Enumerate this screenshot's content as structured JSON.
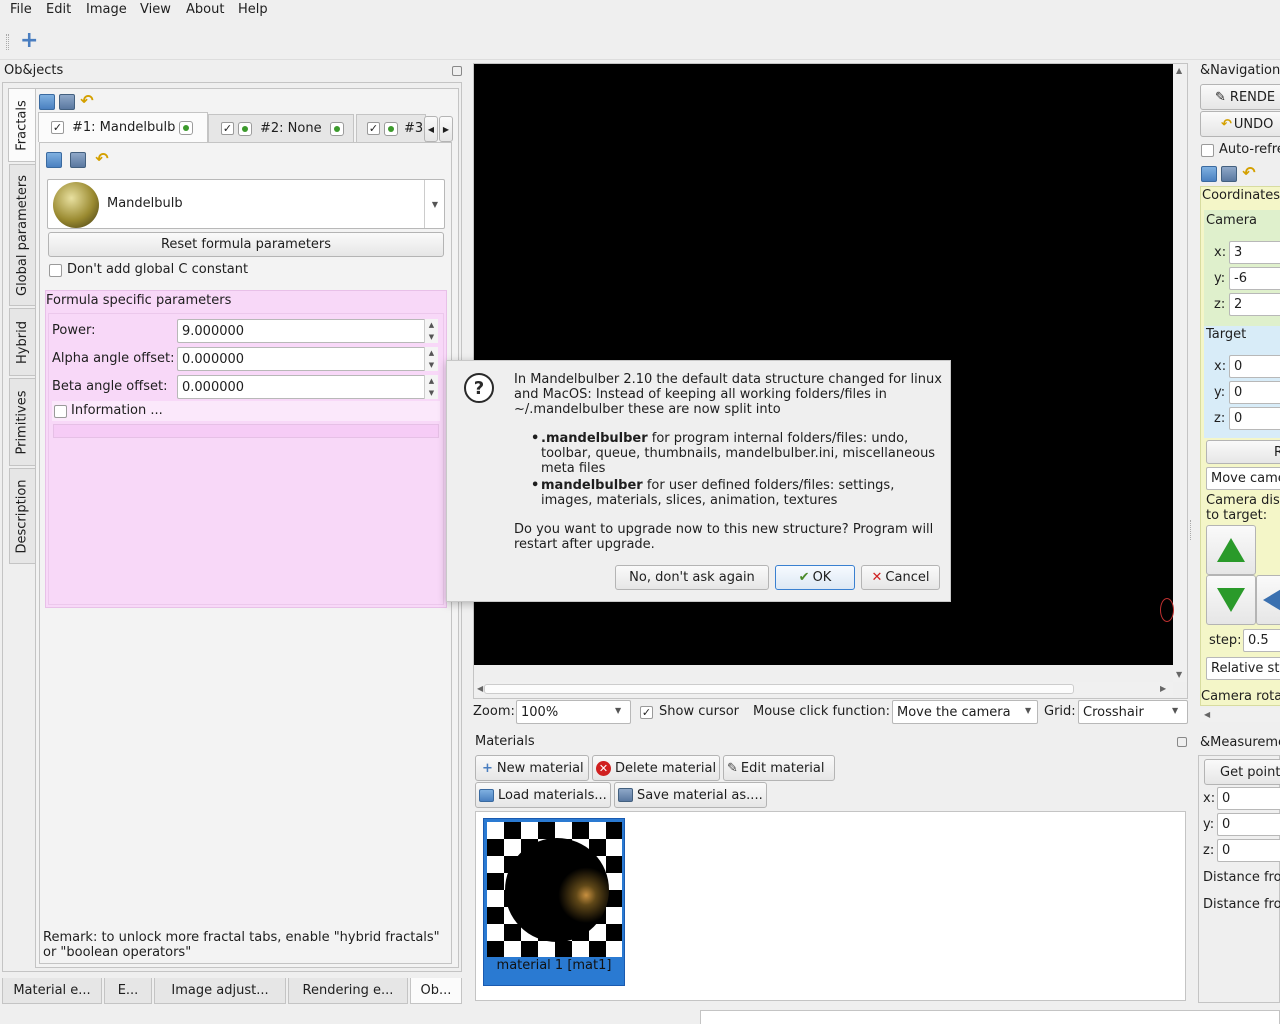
{
  "menu": [
    "File",
    "Edit",
    "Image",
    "View",
    "About",
    "Help"
  ],
  "objects_panel": {
    "title": "Ob&jects",
    "vertical_tabs": [
      "Fractals",
      "Global parameters",
      "Hybrid",
      "Primitives",
      "Description"
    ],
    "fractal_tabs": [
      "#1: Mandelbulb",
      "#2: None",
      "#3"
    ],
    "formula_name": "Mandelbulb",
    "reset_button": "Reset formula parameters",
    "dont_add_c_label": "Don't add global C constant",
    "formula_group_title": "Formula specific parameters",
    "params": [
      {
        "label": "Power:",
        "value": "9.000000"
      },
      {
        "label": "Alpha angle offset:",
        "value": "0.000000"
      },
      {
        "label": "Beta angle offset:",
        "value": "0.000000"
      }
    ],
    "information_label": "Information ...",
    "remark": "Remark: to unlock more fractal tabs, enable \"hybrid fractals\" or \"boolean operators\""
  },
  "bottom_tabs": [
    "Material e...",
    "E...",
    "Image adjust...",
    "Rendering e...",
    "Ob..."
  ],
  "view_controls": {
    "zoom_label": "Zoom:",
    "zoom_value": "100%",
    "show_cursor_label": "Show cursor",
    "mouse_click_label": "Mouse click function:",
    "mouse_click_value": "Move the camera",
    "grid_label": "Grid:",
    "grid_value": "Crosshair"
  },
  "materials": {
    "title": "Materials",
    "new_button": "New material",
    "delete_button": "Delete material",
    "edit_button": "Edit material",
    "load_button": "Load materials...",
    "save_button": "Save material as....",
    "item_label": "material 1 [mat1]"
  },
  "navigation": {
    "title": "&Navigation",
    "render_button": "RENDE",
    "undo_button": "UNDO",
    "autorefresh_label": "Auto-refre",
    "coordinates_label": "Coordinates",
    "camera_label": "Camera",
    "camera": {
      "x": "3",
      "y": "-6",
      "z": "2"
    },
    "target_label": "Target",
    "target": {
      "x": "0",
      "y": "0",
      "z": "0"
    },
    "r_button": "R",
    "move_camera": "Move came",
    "camera_dist_label": "Camera dis to target:",
    "step_label": "step:",
    "step_value": "0.5",
    "relative_label": "Relative st",
    "camera_rotation_label": "Camera rota"
  },
  "measurement": {
    "title": "&Measureme",
    "get_point_button": "Get point",
    "x": "0",
    "y": "0",
    "z": "0",
    "distance1": "Distance fro",
    "distance2": "Distance fro"
  },
  "dialog": {
    "intro": "In Mandelbulber 2.10 the default data structure changed for linux and MacOS: Instead of keeping all working folders/files in ~/.mandelbulber these are now split into",
    "bullet1_bold": ".mandelbulber",
    "bullet1_text": " for program internal folders/files: undo, toolbar, queue, thumbnails, mandelbulber.ini, miscellaneous meta files",
    "bullet2_bold": "mandelbulber",
    "bullet2_text": " for user defined folders/files: settings, images, materials, slices, animation, textures",
    "question": "Do you want to upgrade now to this new structure? Program will restart after upgrade.",
    "no_button": "No, don't ask again",
    "ok_button": "OK",
    "cancel_button": "Cancel"
  }
}
